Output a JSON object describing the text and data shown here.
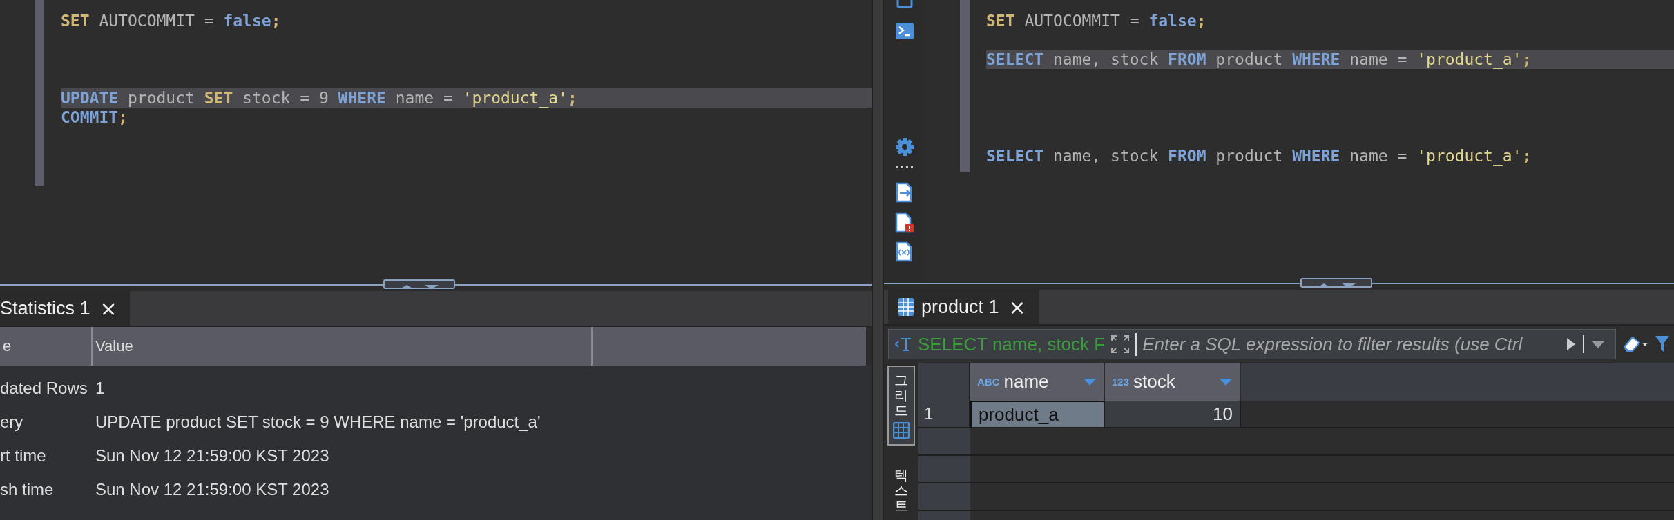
{
  "left_pane": {
    "editor": {
      "lines": [
        {
          "kind": "code",
          "current": false,
          "tokens": [
            {
              "kind": "command",
              "text": "SET"
            },
            {
              "kind": "plain",
              "text": " AUTOCOMMIT = "
            },
            {
              "kind": "keyword",
              "text": "false"
            },
            {
              "kind": "punct",
              "text": ";"
            }
          ]
        },
        {
          "kind": "blank",
          "current": false
        },
        {
          "kind": "blank",
          "current": false
        },
        {
          "kind": "blank",
          "current": false
        },
        {
          "kind": "code",
          "current": true,
          "tokens": [
            {
              "kind": "keyword",
              "text": "UPDATE"
            },
            {
              "kind": "plain",
              "text": " product "
            },
            {
              "kind": "command",
              "text": "SET"
            },
            {
              "kind": "plain",
              "text": " stock = 9 "
            },
            {
              "kind": "keyword",
              "text": "WHERE"
            },
            {
              "kind": "plain",
              "text": " name = "
            },
            {
              "kind": "string",
              "text": "'product_a'"
            },
            {
              "kind": "punct",
              "text": ";"
            }
          ]
        },
        {
          "kind": "code",
          "current": false,
          "tokens": [
            {
              "kind": "keyword",
              "text": "COMMIT"
            },
            {
              "kind": "punct",
              "text": ";"
            }
          ]
        }
      ]
    },
    "results_tab": {
      "label": "Statistics 1",
      "close": "×"
    },
    "stats": {
      "columns": [
        "e",
        "Value"
      ],
      "rows": [
        {
          "name": "dated Rows",
          "value": "1"
        },
        {
          "name": "ery",
          "value": "UPDATE product SET stock = 9 WHERE name = 'product_a'"
        },
        {
          "name": "rt time",
          "value": "Sun Nov 12 21:59:00 KST 2023"
        },
        {
          "name": "sh time",
          "value": "Sun Nov 12 21:59:00 KST 2023"
        }
      ]
    }
  },
  "right_pane": {
    "editor": {
      "lines": [
        {
          "kind": "code",
          "current": false,
          "tokens": [
            {
              "kind": "command",
              "text": "SET"
            },
            {
              "kind": "plain",
              "text": " AUTOCOMMIT = "
            },
            {
              "kind": "keyword",
              "text": "false"
            },
            {
              "kind": "punct",
              "text": ";"
            }
          ]
        },
        {
          "kind": "blank",
          "current": false
        },
        {
          "kind": "code",
          "current": true,
          "tokens": [
            {
              "kind": "keyword",
              "text": "SELECT"
            },
            {
              "kind": "plain",
              "text": " name, stock "
            },
            {
              "kind": "keyword",
              "text": "FROM"
            },
            {
              "kind": "plain",
              "text": " product "
            },
            {
              "kind": "keyword",
              "text": "WHERE"
            },
            {
              "kind": "plain",
              "text": " name = "
            },
            {
              "kind": "string",
              "text": "'product_a'"
            },
            {
              "kind": "punct",
              "text": ";"
            }
          ]
        },
        {
          "kind": "blank",
          "current": false
        },
        {
          "kind": "blank",
          "current": false
        },
        {
          "kind": "blank",
          "current": false
        },
        {
          "kind": "blank",
          "current": false
        },
        {
          "kind": "code",
          "current": false,
          "tokens": [
            {
              "kind": "keyword",
              "text": "SELECT"
            },
            {
              "kind": "plain",
              "text": " name, stock "
            },
            {
              "kind": "keyword",
              "text": "FROM"
            },
            {
              "kind": "plain",
              "text": " product "
            },
            {
              "kind": "keyword",
              "text": "WHERE"
            },
            {
              "kind": "plain",
              "text": " name = "
            },
            {
              "kind": "string",
              "text": "'product_a'"
            },
            {
              "kind": "punct",
              "text": ";"
            }
          ]
        }
      ]
    },
    "results_tab": {
      "label": "product 1",
      "close": "×"
    },
    "filter_bar": {
      "query": "SELECT name, stock F",
      "placeholder": "Enter a SQL expression to filter results (use Ctrl"
    },
    "view_tabs": [
      {
        "label": "그리드",
        "selected": true
      },
      {
        "label": "텍스트",
        "selected": false
      }
    ],
    "grid": {
      "columns": [
        {
          "badge": "ABC",
          "name": "name",
          "kind": "text"
        },
        {
          "badge": "123",
          "name": "stock",
          "kind": "number"
        }
      ],
      "rows": [
        {
          "number": "1",
          "cells": [
            {
              "value": "product_a",
              "selected": true
            },
            {
              "value": "10",
              "selected": false
            }
          ]
        }
      ]
    }
  }
}
